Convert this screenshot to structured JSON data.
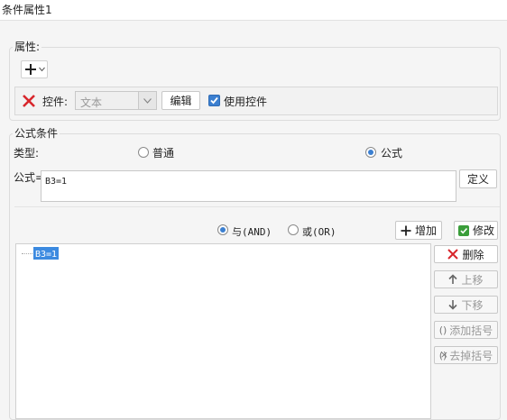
{
  "window": {
    "title": "条件属性1"
  },
  "properties": {
    "legend": "属性:",
    "control_label": "控件:",
    "control_type_value": "文本",
    "edit_button": "编辑",
    "use_control_label": "使用控件",
    "use_control_checked": true
  },
  "formula_condition": {
    "legend": "公式条件",
    "type_label": "类型:",
    "type_normal": "普通",
    "type_formula": "公式",
    "selected_type": "formula",
    "formula_label": "公式=",
    "formula_value": "B3=1",
    "define_button": "定义",
    "logic_and": "与(AND)",
    "logic_or": "或(OR)",
    "selected_logic": "and",
    "add_button": "增加",
    "modify_button": "修改",
    "condition_items": [
      "B3=1"
    ],
    "side_buttons": {
      "delete": "删除",
      "move_up": "上移",
      "move_down": "下移",
      "add_brackets": "添加括号",
      "remove_brackets": "去掉括号"
    }
  },
  "colors": {
    "accent": "#3b7fd0",
    "selection": "#3c8ae0",
    "delete_red": "#d8262c",
    "add_green": "#3a9d3a"
  }
}
